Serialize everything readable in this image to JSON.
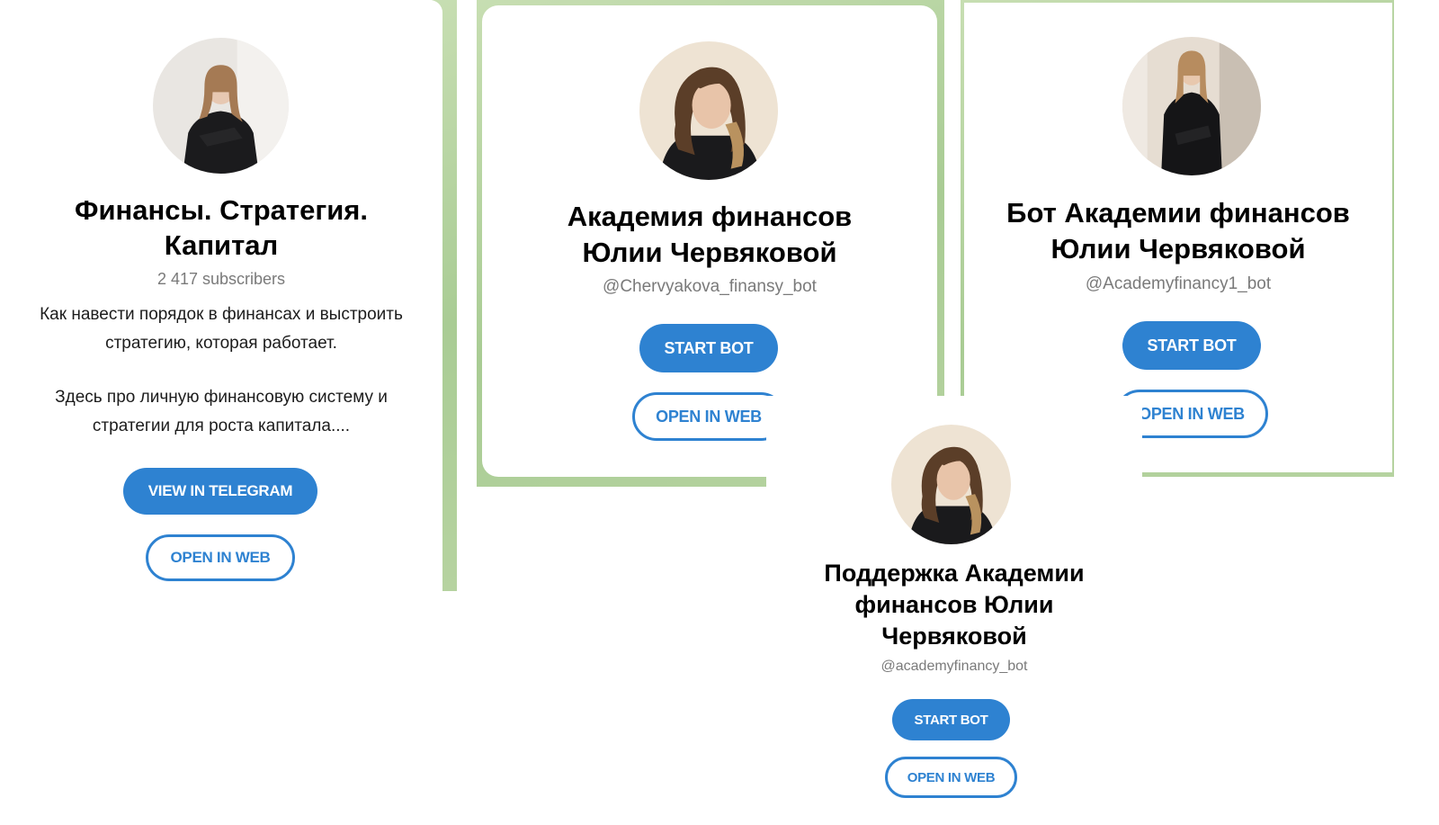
{
  "cards": [
    {
      "title": "Финансы. Стратегия. Капитал",
      "subtitle": "2 417 subscribers",
      "description_1": "Как навести порядок в финансах и выстроить стратегию, которая работает.",
      "description_2": "Здесь про личную финансовую систему и стратегии для роста капитала....",
      "primary_button": "VIEW IN TELEGRAM",
      "secondary_button": "OPEN IN WEB"
    },
    {
      "title": "Академия финансов Юлии Червяковой",
      "subtitle": "@Chervyakova_finansy_bot",
      "primary_button": "START BOT",
      "secondary_button": "OPEN IN WEB"
    },
    {
      "title": "Бот Академии финансов Юлии Червяковой",
      "subtitle": "@Academyfinancy1_bot",
      "primary_button": "START BOT",
      "secondary_button": "OPEN IN WEB"
    },
    {
      "title": "Поддержка Академии финансов Юлии Червяковой",
      "subtitle": "@academyfinancy_bot",
      "primary_button": "START BOT",
      "secondary_button": "OPEN IN WEB"
    }
  ],
  "colors": {
    "accent": "#2e82d1",
    "background_green": "#b6d3a0",
    "subtitle_gray": "#7a7a7a"
  },
  "icons": [
    "avatar-photo"
  ]
}
